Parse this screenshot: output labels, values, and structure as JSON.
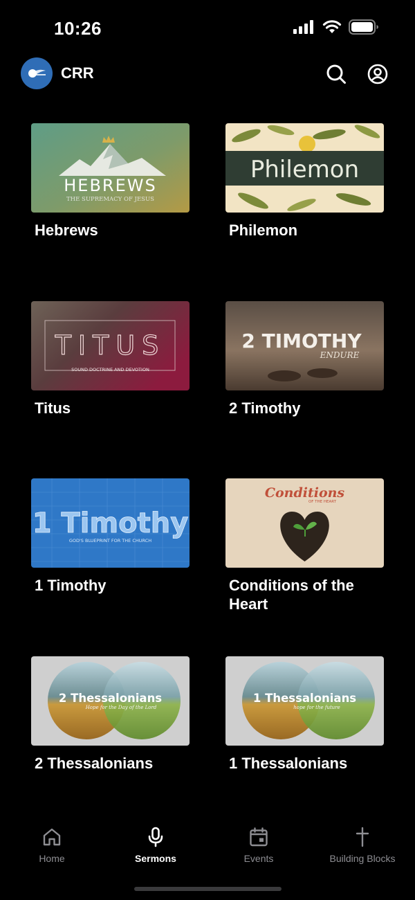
{
  "status_bar": {
    "time": "10:26"
  },
  "header": {
    "app_name": "CRR"
  },
  "sermons": [
    {
      "title": "Hebrews",
      "art_title": "HEBREWS",
      "art_subtitle": "THE SUPREMACY OF JESUS"
    },
    {
      "title": "Philemon",
      "art_title": "Philemon"
    },
    {
      "title": "Titus",
      "art_title": "TITUS",
      "art_subtitle": "SOUND DOCTRINE AND DEVOTION"
    },
    {
      "title": "2 Timothy",
      "art_title": "2 TIMOTHY",
      "art_subtitle": "ENDURE"
    },
    {
      "title": "1 Timothy",
      "art_title": "1 Timothy",
      "art_subtitle": "GOD'S BLUEPRINT FOR THE CHURCH"
    },
    {
      "title": "Conditions of the Heart",
      "art_title": "Conditions",
      "art_subtitle": "OF THE HEART"
    },
    {
      "title": "2 Thessalonians",
      "art_title": "2 Thessalonians",
      "art_subtitle": "Hope for the Day of the Lord"
    },
    {
      "title": "1 Thessalonians",
      "art_title": "1 Thessalonians",
      "art_subtitle": "hope for the future"
    }
  ],
  "tabs": [
    {
      "label": "Home",
      "icon": "home-icon",
      "active": false
    },
    {
      "label": "Sermons",
      "icon": "microphone-icon",
      "active": true
    },
    {
      "label": "Events",
      "icon": "calendar-icon",
      "active": false
    },
    {
      "label": "Building Blocks",
      "icon": "cross-icon",
      "active": false
    }
  ],
  "colors": {
    "background": "#000000",
    "active_tab": "#ffffff",
    "inactive_tab": "#8e8e93",
    "logo_blue": "#2f6db6"
  }
}
